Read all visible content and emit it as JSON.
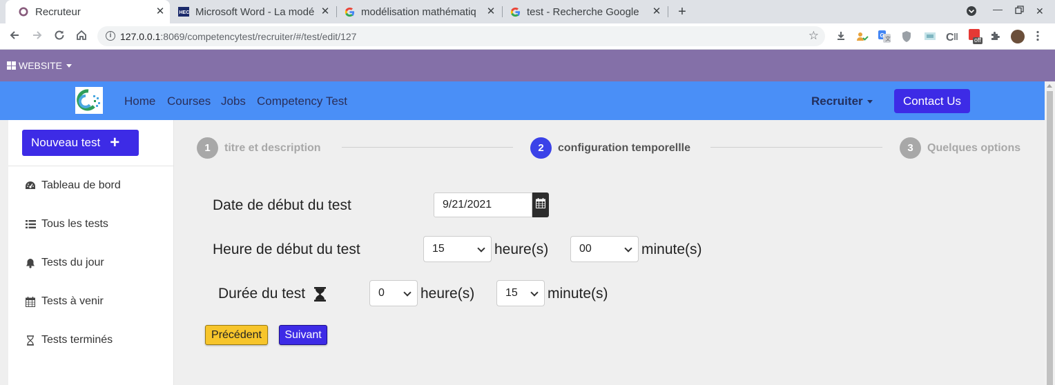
{
  "browser": {
    "tabs": [
      {
        "title": "Recruteur",
        "icon": "odoo-icon",
        "active": true
      },
      {
        "title": "Microsoft Word - La modé",
        "icon": "hec-icon"
      },
      {
        "title": "modélisation mathématiq",
        "icon": "google-icon"
      },
      {
        "title": "test - Recherche Google",
        "icon": "google-icon"
      }
    ],
    "url_host": "127.0.0.1",
    "url_rest": ":8069/competencytest/recruiter/#/test/edit/127",
    "extension_badge": "off"
  },
  "website_bar": {
    "label": "WEBSITE"
  },
  "header": {
    "menu": [
      "Home",
      "Courses",
      "Jobs",
      "Competency Test"
    ],
    "user_menu": "Recruiter",
    "contact_label": "Contact Us"
  },
  "sidebar": {
    "new_test_label": "Nouveau test",
    "items": [
      {
        "label": "Tableau de bord",
        "icon": "dashboard-icon"
      },
      {
        "label": "Tous les tests",
        "icon": "list-icon"
      },
      {
        "label": "Tests du jour",
        "icon": "bell-icon"
      },
      {
        "label": "Tests à venir",
        "icon": "calendar-icon"
      },
      {
        "label": "Tests terminés",
        "icon": "hourglass-icon"
      }
    ]
  },
  "stepper": {
    "steps": [
      {
        "num": "1",
        "label": "titre et description",
        "state": "inactive"
      },
      {
        "num": "2",
        "label": "configuration temporellle",
        "state": "active"
      },
      {
        "num": "3",
        "label": "Quelques options",
        "state": "inactive"
      }
    ]
  },
  "form": {
    "start_date_label": "Date de début du test",
    "start_date_value": "9/21/2021",
    "start_time_label": "Heure de début du test",
    "start_hour_value": "15",
    "start_minute_value": "00",
    "duration_label": "Durée du test",
    "duration_hour_value": "0",
    "duration_minute_value": "15",
    "hours_unit": "heure(s)",
    "minutes_unit": "minute(s)"
  },
  "actions": {
    "previous_label": "Précédent",
    "next_label": "Suivant"
  },
  "colors": {
    "website_bar": "#8470a8",
    "header": "#4a8ff7",
    "primary": "#3d2be6",
    "warning": "#f7c52b",
    "step_active": "#3b42e8",
    "step_inactive": "#a8a8a8"
  }
}
